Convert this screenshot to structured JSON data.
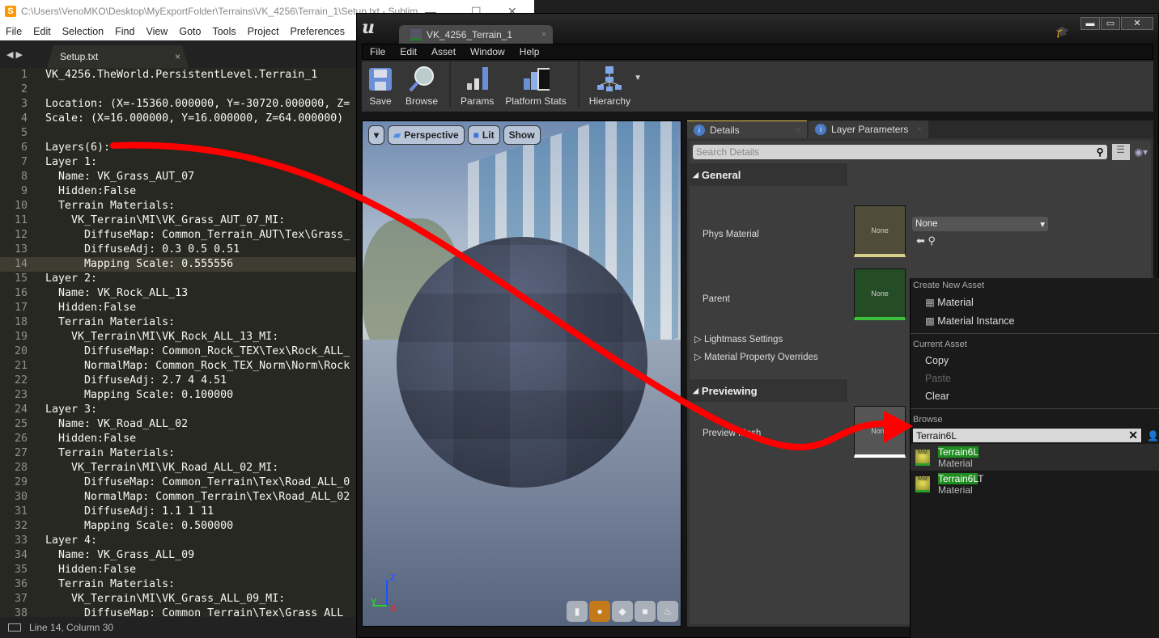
{
  "sublime": {
    "title": "C:\\Users\\VenoMKO\\Desktop\\MyExportFolder\\Terrains\\VK_4256\\Terrain_1\\Setup.txt - Sublim",
    "menu": [
      "File",
      "Edit",
      "Selection",
      "Find",
      "View",
      "Goto",
      "Tools",
      "Project",
      "Preferences",
      "Help"
    ],
    "tab": "Setup.txt",
    "current_line": 14,
    "lines": [
      "VK_4256.TheWorld.PersistentLevel.Terrain_1",
      "",
      "Location: (X=-15360.000000, Y=-30720.000000, Z=",
      "Scale: (X=16.000000, Y=16.000000, Z=64.000000)",
      "",
      "Layers(6):",
      "Layer 1:",
      "  Name: VK_Grass_AUT_07",
      "  Hidden:False",
      "  Terrain Materials:",
      "    VK_Terrain\\MI\\VK_Grass_AUT_07_MI:",
      "      DiffuseMap: Common_Terrain_AUT\\Tex\\Grass_",
      "      DiffuseAdj: 0.3 0.5 0.51",
      "      Mapping Scale: 0.555556",
      "Layer 2:",
      "  Name: VK_Rock_ALL_13",
      "  Hidden:False",
      "  Terrain Materials:",
      "    VK_Terrain\\MI\\VK_Rock_ALL_13_MI:",
      "      DiffuseMap: Common_Rock_TEX\\Tex\\Rock_ALL_",
      "      NormalMap: Common_Rock_TEX_Norm\\Norm\\Rock",
      "      DiffuseAdj: 2.7 4 4.51",
      "      Mapping Scale: 0.100000",
      "Layer 3:",
      "  Name: VK_Road_ALL_02",
      "  Hidden:False",
      "  Terrain Materials:",
      "    VK_Terrain\\MI\\VK_Road_ALL_02_MI:",
      "      DiffuseMap: Common_Terrain\\Tex\\Road_ALL_0",
      "      NormalMap: Common_Terrain\\Tex\\Road_ALL_02",
      "      DiffuseAdj: 1.1 1 11",
      "      Mapping Scale: 0.500000",
      "Layer 4:",
      "  Name: VK_Grass_ALL_09",
      "  Hidden:False",
      "  Terrain Materials:",
      "    VK_Terrain\\MI\\VK_Grass_ALL_09_MI:",
      "      DiffuseMap: Common_Terrain\\Tex\\Grass_ALL"
    ],
    "status": "Line 14, Column 30"
  },
  "ue": {
    "tab": "VK_4256_Terrain_1",
    "menu": [
      "File",
      "Edit",
      "Asset",
      "Window",
      "Help"
    ],
    "toolbar": [
      {
        "label": "Save",
        "icon": "save-icon"
      },
      {
        "label": "Browse",
        "icon": "browse-icon"
      },
      {
        "label": "Params",
        "icon": "params-icon"
      },
      {
        "label": "Platform Stats",
        "icon": "platform-stats-icon"
      },
      {
        "label": "Hierarchy",
        "icon": "hierarchy-icon"
      }
    ],
    "viewport": {
      "menu": "▾",
      "perspective": "Perspective",
      "lit": "Lit",
      "show": "Show",
      "axes": {
        "z": "Z",
        "y": "Y",
        "x": "X"
      }
    },
    "details": {
      "tabs": [
        "Details",
        "Layer Parameters"
      ],
      "search_placeholder": "Search Details",
      "general": "General",
      "phys_material": "Phys Material",
      "phys_value": "None",
      "parent": "Parent",
      "parent_value": "None",
      "thumb_none": "None",
      "lightmass": "Lightmass Settings",
      "overrides": "Material Property Overrides",
      "previewing": "Previewing",
      "preview_mesh": "Preview Mesh"
    },
    "dropdown": {
      "create_header": "Create New Asset",
      "create_items": [
        "Material",
        "Material Instance"
      ],
      "current_header": "Current Asset",
      "copy": "Copy",
      "paste": "Paste",
      "clear": "Clear",
      "browse_header": "Browse",
      "search_value": "Terrain6L",
      "results": [
        {
          "hl": "Terrain6L",
          "rest": "",
          "type": "Material"
        },
        {
          "hl": "Terrain6L",
          "rest": "T",
          "type": "Material"
        }
      ]
    }
  }
}
